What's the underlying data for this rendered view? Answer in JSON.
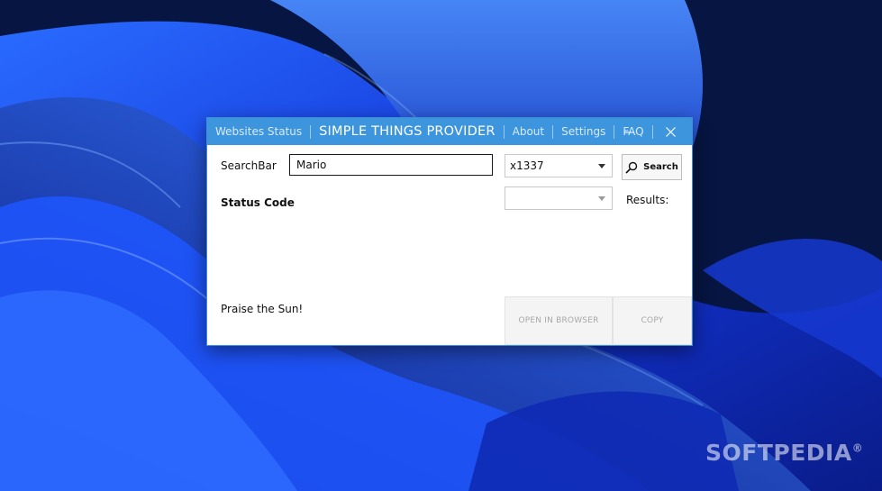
{
  "window": {
    "menu": {
      "websites_status": "Websites Status",
      "title": "SIMPLE THINGS PROVIDER",
      "about": "About",
      "settings": "Settings",
      "faq": "FAQ"
    },
    "controls": {
      "minimize_icon": "minimize-icon",
      "close_icon": "close-icon"
    },
    "searchbar_label": "SearchBar",
    "search_value": "Mario",
    "mode_select_value": "x1337",
    "search_button": "Search",
    "status_code_label": "Status Code",
    "results_select_value": "",
    "results_label": "Results:",
    "footer_text": "Praise the Sun!",
    "open_in_browser": "OPEN IN BROWSER",
    "copy": "COPY"
  },
  "watermark": {
    "text": "SOFTPEDIA",
    "mark": "®"
  },
  "colors": {
    "titlebar": "#3c95dd",
    "accent": "#3b8fd9",
    "desktop_dark": "#040c2a",
    "wallpaper_blue": "#1a4cff"
  }
}
